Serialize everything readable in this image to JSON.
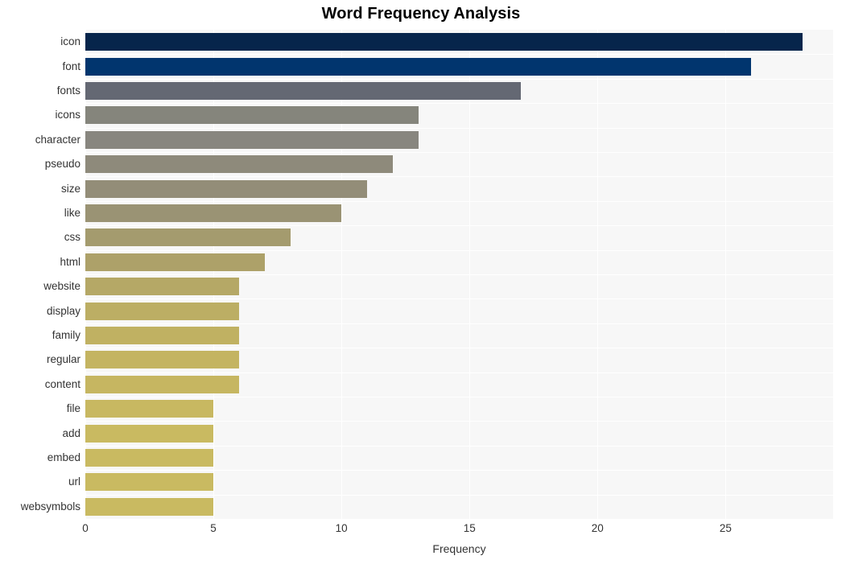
{
  "chart_data": {
    "type": "bar",
    "orientation": "horizontal",
    "title": "Word Frequency Analysis",
    "xlabel": "Frequency",
    "ylabel": "",
    "xlim": [
      0,
      29.2
    ],
    "xticks": [
      0,
      5,
      10,
      15,
      20,
      25
    ],
    "xtick_labels": [
      "0",
      "5",
      "10",
      "15",
      "20",
      "25"
    ],
    "grid": true,
    "grid_color": "#ffffff",
    "plot_background": "#f7f7f7",
    "legend": null,
    "categories": [
      "icon",
      "font",
      "fonts",
      "icons",
      "character",
      "pseudo",
      "size",
      "like",
      "css",
      "html",
      "website",
      "display",
      "family",
      "regular",
      "content",
      "file",
      "add",
      "embed",
      "url",
      "websymbols"
    ],
    "values": [
      28,
      26,
      17,
      13,
      13,
      12,
      11,
      10,
      8,
      7,
      6,
      6,
      6,
      6,
      6,
      5,
      5,
      5,
      5,
      5
    ],
    "bar_colors": [
      "#06254b",
      "#01356e",
      "#646873",
      "#85857c",
      "#88867f",
      "#8e8a7b",
      "#938d78",
      "#9a9374",
      "#a49b6e",
      "#ada169",
      "#b5a866",
      "#bcae64",
      "#c0b162",
      "#c4b461",
      "#c6b661",
      "#c8b861",
      "#c9ba61",
      "#c9ba61",
      "#c9ba61",
      "#c9ba61"
    ],
    "bars": [
      {
        "label": "icon",
        "value": 28,
        "color": "#06254b"
      },
      {
        "label": "font",
        "value": 26,
        "color": "#01356e"
      },
      {
        "label": "fonts",
        "value": 17,
        "color": "#646873"
      },
      {
        "label": "icons",
        "value": 13,
        "color": "#85857c"
      },
      {
        "label": "character",
        "value": 13,
        "color": "#88867f"
      },
      {
        "label": "pseudo",
        "value": 12,
        "color": "#8e8a7b"
      },
      {
        "label": "size",
        "value": 11,
        "color": "#938d78"
      },
      {
        "label": "like",
        "value": 10,
        "color": "#9a9374"
      },
      {
        "label": "css",
        "value": 8,
        "color": "#a49b6e"
      },
      {
        "label": "html",
        "value": 7,
        "color": "#ada169"
      },
      {
        "label": "website",
        "value": 6,
        "color": "#b5a866"
      },
      {
        "label": "display",
        "value": 6,
        "color": "#bcae64"
      },
      {
        "label": "family",
        "value": 6,
        "color": "#c0b162"
      },
      {
        "label": "regular",
        "value": 6,
        "color": "#c4b461"
      },
      {
        "label": "content",
        "value": 6,
        "color": "#c6b661"
      },
      {
        "label": "file",
        "value": 5,
        "color": "#c8b861"
      },
      {
        "label": "add",
        "value": 5,
        "color": "#c9ba61"
      },
      {
        "label": "embed",
        "value": 5,
        "color": "#c9ba61"
      },
      {
        "label": "url",
        "value": 5,
        "color": "#c9ba61"
      },
      {
        "label": "websymbols",
        "value": 5,
        "color": "#c9ba61"
      }
    ]
  }
}
